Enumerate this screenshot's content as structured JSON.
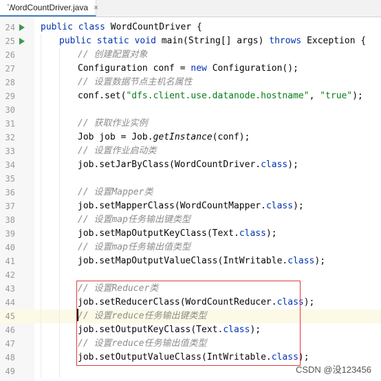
{
  "editor_tab": {
    "title": "WordCountDriver.java",
    "close": "×"
  },
  "colors": {
    "keyword": "#0033b3",
    "comment": "#8c8c8c",
    "string": "#067d17",
    "highlight_border": "#e03a3a",
    "current_line": "#fcfae6",
    "run_icon": "#3c9a4e"
  },
  "lines": [
    {
      "n": "24",
      "run": true,
      "indent": 0,
      "tokens": [
        [
          "kw",
          "public "
        ],
        [
          "kw",
          "class "
        ],
        [
          "",
          "WordCountDriver {"
        ]
      ]
    },
    {
      "n": "25",
      "run": true,
      "indent": 1,
      "tokens": [
        [
          "kw",
          "public "
        ],
        [
          "kw",
          "static "
        ],
        [
          "kw",
          "void "
        ],
        [
          "",
          "main(String[] args) "
        ],
        [
          "kw",
          "throws "
        ],
        [
          "",
          "Exception {"
        ]
      ]
    },
    {
      "n": "26",
      "indent": 2,
      "tokens": [
        [
          "cm",
          "// 创建配置对象"
        ]
      ]
    },
    {
      "n": "27",
      "indent": 2,
      "tokens": [
        [
          "",
          "Configuration conf = "
        ],
        [
          "kw",
          "new "
        ],
        [
          "",
          "Configuration();"
        ]
      ]
    },
    {
      "n": "28",
      "indent": 2,
      "tokens": [
        [
          "cm",
          "// 设置数据节点主机名属性"
        ]
      ]
    },
    {
      "n": "29",
      "indent": 2,
      "tokens": [
        [
          "",
          "conf.set("
        ],
        [
          "st",
          "\"dfs.client.use.datanode.hostname\""
        ],
        [
          "",
          ", "
        ],
        [
          "st",
          "\"true\""
        ],
        [
          "",
          ");"
        ]
      ]
    },
    {
      "n": "30",
      "indent": 2,
      "tokens": []
    },
    {
      "n": "31",
      "indent": 2,
      "tokens": [
        [
          "cm",
          "// 获取作业实例"
        ]
      ]
    },
    {
      "n": "32",
      "indent": 2,
      "tokens": [
        [
          "",
          "Job job = Job."
        ],
        [
          "it",
          "getInstance"
        ],
        [
          "",
          "(conf);"
        ]
      ]
    },
    {
      "n": "33",
      "indent": 2,
      "tokens": [
        [
          "cm",
          "// 设置作业启动类"
        ]
      ]
    },
    {
      "n": "34",
      "indent": 2,
      "tokens": [
        [
          "",
          "job.setJarByClass(WordCountDriver."
        ],
        [
          "kw",
          "class"
        ],
        [
          "",
          ");"
        ]
      ]
    },
    {
      "n": "35",
      "indent": 2,
      "tokens": []
    },
    {
      "n": "36",
      "indent": 2,
      "tokens": [
        [
          "cm",
          "// 设置Mapper类"
        ]
      ]
    },
    {
      "n": "37",
      "indent": 2,
      "tokens": [
        [
          "",
          "job.setMapperClass(WordCountMapper."
        ],
        [
          "kw",
          "class"
        ],
        [
          "",
          ");"
        ]
      ]
    },
    {
      "n": "38",
      "indent": 2,
      "tokens": [
        [
          "cm",
          "// 设置map任务输出键类型"
        ]
      ]
    },
    {
      "n": "39",
      "indent": 2,
      "tokens": [
        [
          "",
          "job.setMapOutputKeyClass(Text."
        ],
        [
          "kw",
          "class"
        ],
        [
          "",
          ");"
        ]
      ]
    },
    {
      "n": "40",
      "indent": 2,
      "tokens": [
        [
          "cm",
          "// 设置map任务输出值类型"
        ]
      ]
    },
    {
      "n": "41",
      "indent": 2,
      "tokens": [
        [
          "",
          "job.setMapOutputValueClass(IntWritable."
        ],
        [
          "kw",
          "class"
        ],
        [
          "",
          ");"
        ]
      ]
    },
    {
      "n": "42",
      "indent": 2,
      "tokens": []
    },
    {
      "n": "43",
      "indent": 2,
      "tokens": [
        [
          "cm",
          "// 设置Reducer类"
        ]
      ]
    },
    {
      "n": "44",
      "indent": 2,
      "tokens": [
        [
          "",
          "job.setReducerClass(WordCountReducer."
        ],
        [
          "kw",
          "class"
        ],
        [
          "",
          ");"
        ]
      ]
    },
    {
      "n": "45",
      "indent": 2,
      "current": true,
      "tokens": [
        [
          "cm",
          "// 设置reduce任务输出键类型"
        ]
      ]
    },
    {
      "n": "46",
      "indent": 2,
      "tokens": [
        [
          "",
          "job.setOutputKeyClass(Text."
        ],
        [
          "kw",
          "class"
        ],
        [
          "",
          ");"
        ]
      ]
    },
    {
      "n": "47",
      "indent": 2,
      "tokens": [
        [
          "cm",
          "// 设置reduce任务输出值类型"
        ]
      ]
    },
    {
      "n": "48",
      "indent": 2,
      "tokens": [
        [
          "",
          "job.setOutputValueClass(IntWritable."
        ],
        [
          "kw",
          "class"
        ],
        [
          "",
          ");"
        ]
      ]
    },
    {
      "n": "49",
      "indent": 2,
      "tokens": []
    }
  ],
  "watermark": "CSDN @没123456"
}
